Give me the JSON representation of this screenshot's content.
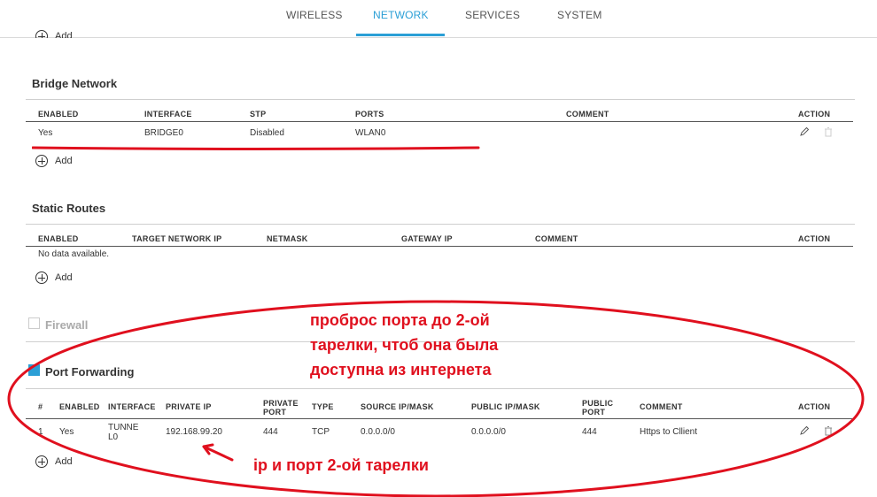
{
  "nav": {
    "tabs": [
      {
        "label": "WIRELESS"
      },
      {
        "label": "NETWORK",
        "active": true
      },
      {
        "label": "SERVICES"
      },
      {
        "label": "SYSTEM"
      }
    ]
  },
  "top_add_label": "Add",
  "bridge": {
    "title": "Bridge Network",
    "columns": [
      "ENABLED",
      "INTERFACE",
      "STP",
      "PORTS",
      "COMMENT",
      "ACTION"
    ],
    "rows": [
      {
        "enabled": "Yes",
        "interface": "BRIDGE0",
        "stp": "Disabled",
        "ports": "WLAN0",
        "comment": ""
      }
    ],
    "add_label": "Add"
  },
  "static_routes": {
    "title": "Static Routes",
    "columns": [
      "ENABLED",
      "TARGET NETWORK IP",
      "NETMASK",
      "GATEWAY IP",
      "COMMENT",
      "ACTION"
    ],
    "empty_text": "No data available.",
    "add_label": "Add"
  },
  "firewall": {
    "label": "Firewall",
    "checked": false
  },
  "port_forwarding": {
    "label": "Port Forwarding",
    "checked": true,
    "columns": {
      "num": "#",
      "enabled": "ENABLED",
      "interface": "INTERFACE",
      "private_ip": "PRIVATE IP",
      "private_port_1": "PRIVATE",
      "private_port_2": "PORT",
      "type": "TYPE",
      "source": "SOURCE IP/MASK",
      "public_ip": "PUBLIC IP/MASK",
      "public_port_1": "PUBLIC",
      "public_port_2": "PORT",
      "comment": "COMMENT",
      "action": "ACTION"
    },
    "rows": [
      {
        "num": "1",
        "enabled": "Yes",
        "interface_1": "TUNNE",
        "interface_2": "L0",
        "private_ip": "192.168.99.20",
        "private_port": "444",
        "type": "TCP",
        "source": "0.0.0.0/0",
        "public_ip": "0.0.0.0/0",
        "public_port": "444",
        "comment": "Https to Cllient"
      }
    ],
    "add_label": "Add"
  },
  "annotations": {
    "note_line1": "проброс порта до 2-ой",
    "note_line2": "тарелки, чтоб она была",
    "note_line3": "доступна из интернета",
    "ip_note": "ip и порт 2-ой тарелки",
    "color": "#e0101e"
  },
  "colors": {
    "accent": "#2b9fd6",
    "annotation": "#e0101e"
  }
}
